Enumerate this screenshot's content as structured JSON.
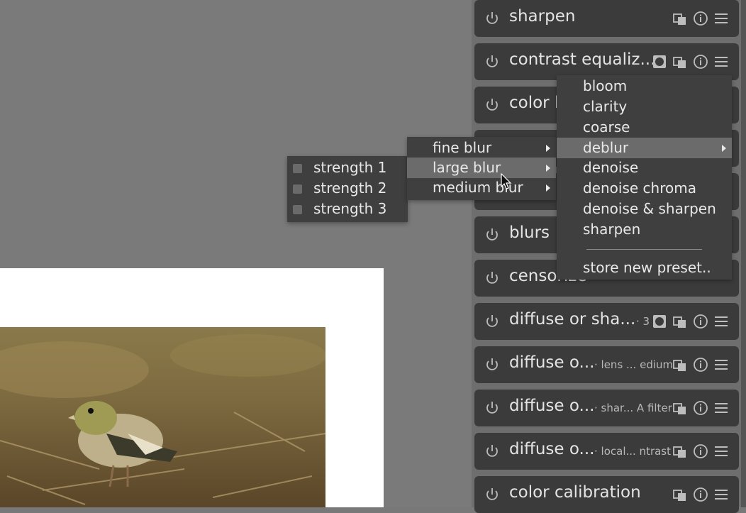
{
  "modules": [
    {
      "name": "sharpen",
      "label": "",
      "icons": [
        "multi-instance-icon",
        "info-icon",
        "presets-icon"
      ]
    },
    {
      "name": "contrast equaliz...",
      "label": "",
      "icons": [
        "mask-icon",
        "multi-instance-icon",
        "info-icon",
        "presets-icon"
      ]
    },
    {
      "name": "color l",
      "label": "",
      "icons": []
    },
    {
      "name": "",
      "label": "",
      "icons": []
    },
    {
      "name": "",
      "label": "",
      "icons": []
    },
    {
      "name": "blurs",
      "label": "",
      "icons": []
    },
    {
      "name": "censorize",
      "label": "",
      "icons": []
    },
    {
      "name": "diffuse or sha...",
      "label": "· 3",
      "icons": [
        "mask-icon",
        "multi-instance-icon",
        "info-icon",
        "presets-icon"
      ]
    },
    {
      "name": "diffuse o...",
      "label": "· lens ... edium",
      "icons": [
        "multi-instance-icon",
        "info-icon",
        "presets-icon"
      ]
    },
    {
      "name": "diffuse o...",
      "label": "· shar... A filter",
      "icons": [
        "multi-instance-icon",
        "info-icon",
        "presets-icon"
      ]
    },
    {
      "name": "diffuse o...",
      "label": "· local... ntrast",
      "icons": [
        "multi-instance-icon",
        "info-icon",
        "presets-icon"
      ]
    },
    {
      "name": "color calibration",
      "label": "",
      "icons": [
        "multi-instance-icon",
        "info-icon",
        "presets-icon"
      ]
    }
  ],
  "presets_menu": {
    "items": [
      "bloom",
      "clarity",
      "coarse",
      "deblur",
      "denoise",
      "denoise chroma",
      "denoise & sharpen",
      "sharpen"
    ],
    "highlighted": "deblur",
    "store_label": "store new preset.."
  },
  "deblur_menu": {
    "items": [
      "fine blur",
      "large blur",
      "medium blur"
    ],
    "highlighted": "large blur"
  },
  "strength_menu": {
    "items": [
      "strength 1",
      "strength 2",
      "strength 3"
    ]
  },
  "colors": {
    "module_bg": "#3b3b3b",
    "menu_bg": "#3f3f3f",
    "highlight": "#6b6b6b"
  }
}
